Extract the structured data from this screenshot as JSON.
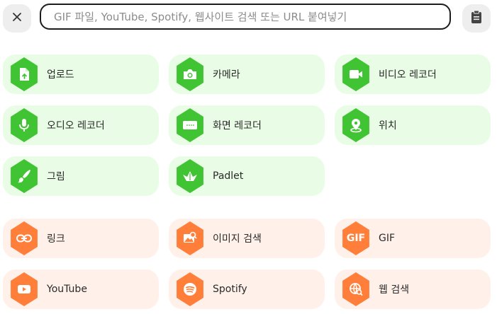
{
  "search": {
    "placeholder": "GIF 파일, YouTube, Spotify, 웹사이트 검색 또는 URL 붙여넣기"
  },
  "colors": {
    "green_tile": "#e9fde6",
    "green_icon": "#41c433",
    "orange_tile": "#fff1ea",
    "orange_icon": "#ff7f3a"
  },
  "create_options": [
    {
      "label": "업로드",
      "icon": "upload-file-icon"
    },
    {
      "label": "카메라",
      "icon": "camera-icon"
    },
    {
      "label": "비디오 레코더",
      "icon": "video-camera-icon"
    },
    {
      "label": "오디오 레코더",
      "icon": "microphone-icon"
    },
    {
      "label": "화면 레코더",
      "icon": "screen-recorder-icon"
    },
    {
      "label": "위치",
      "icon": "location-pin-icon"
    },
    {
      "label": "그림",
      "icon": "paintbrush-icon"
    },
    {
      "label": "Padlet",
      "icon": "padlet-logo-icon"
    }
  ],
  "search_options": [
    {
      "label": "링크",
      "icon": "link-icon"
    },
    {
      "label": "이미지 검색",
      "icon": "image-search-icon"
    },
    {
      "label": "GIF",
      "icon": "gif-icon",
      "icon_text": "GIF"
    },
    {
      "label": "YouTube",
      "icon": "youtube-icon"
    },
    {
      "label": "Spotify",
      "icon": "spotify-icon"
    },
    {
      "label": "웹 검색",
      "icon": "web-search-icon"
    }
  ]
}
